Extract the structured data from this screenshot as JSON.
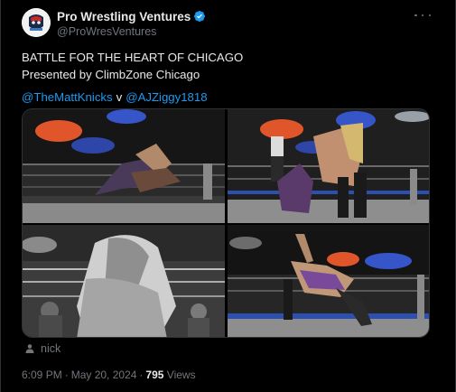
{
  "post": {
    "author": {
      "display_name": "Pro Wrestling Ventures",
      "handle": "@ProWresVentures",
      "verified": true
    },
    "lines": {
      "title": "BATTLE FOR THE HEART OF CHICAGO",
      "presented": "Presented by ClimbZone Chicago"
    },
    "mentions": {
      "first": "@TheMattKnicks",
      "separator": "v",
      "second": "@AJZiggy1818"
    },
    "tagged_user": "nick",
    "timestamp": {
      "time": "6:09 PM",
      "date": "May 20, 2024",
      "dot": "·",
      "views_count": "795",
      "views_label": "Views"
    }
  },
  "colors": {
    "background": "#000000",
    "text_primary": "#e7e9ea",
    "text_secondary": "#71767b",
    "link": "#1d9bf0",
    "verified": "#1d9bf0",
    "border": "#2f3336"
  },
  "icons": {
    "verified": "verified-badge-icon",
    "more": "more-options-icon",
    "tagged": "user-icon"
  }
}
